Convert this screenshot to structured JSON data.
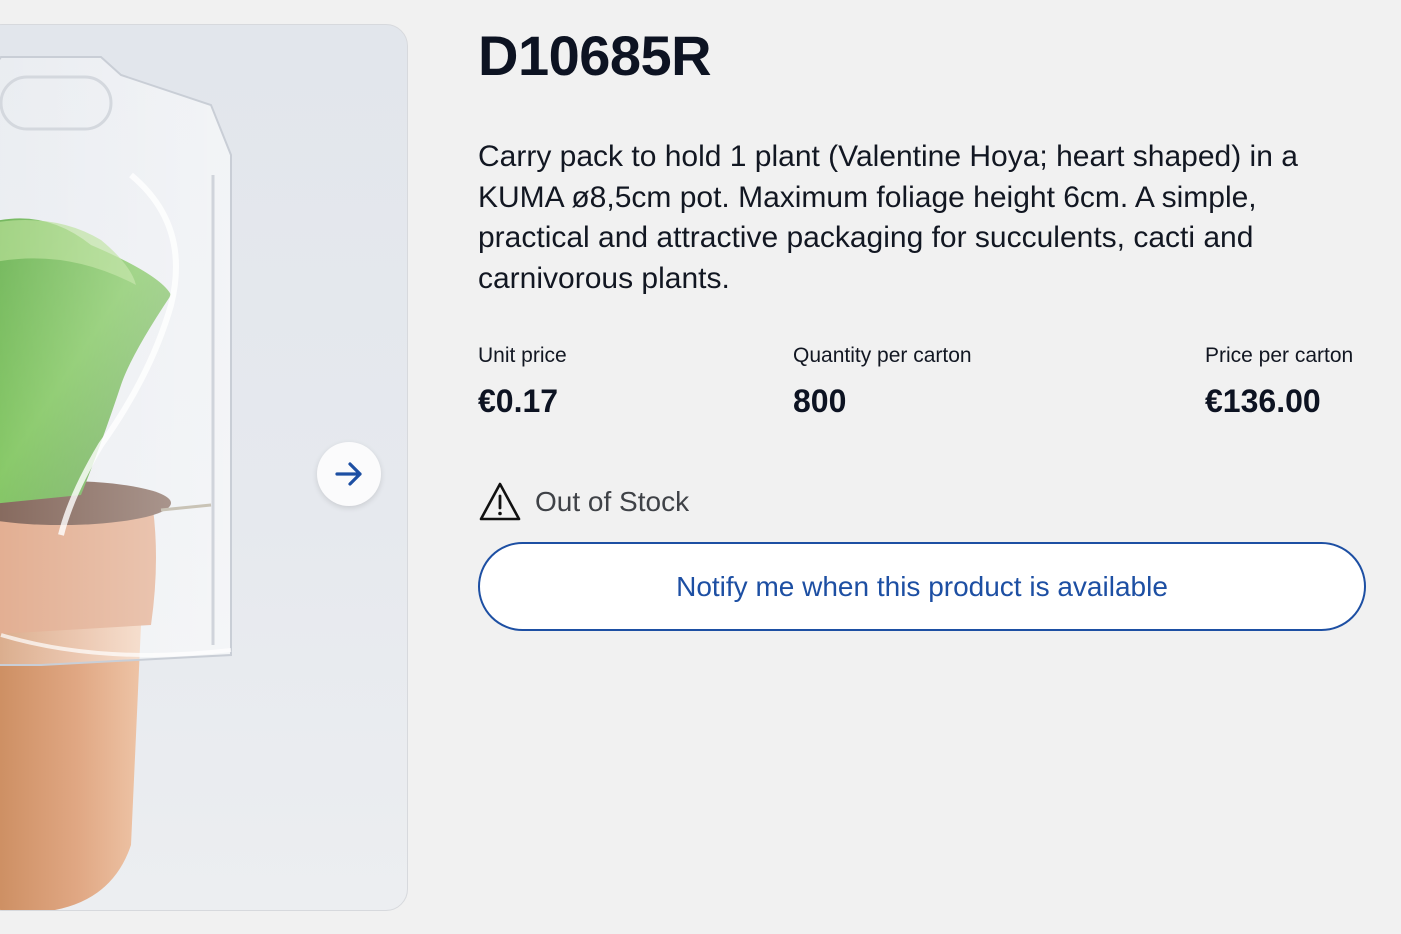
{
  "product": {
    "sku": "D10685R",
    "description": "Carry pack to hold 1 plant (Valentine Hoya; heart shaped) in a KUMA ø8,5cm pot. Maximum foliage height 6cm. A simple, practical and attractive packaging for succulents, cacti and carnivorous plants."
  },
  "gallery": {
    "next_icon": "arrow-right-icon"
  },
  "pricing": {
    "unit_price_label": "Unit price",
    "unit_price_value": "€0.17",
    "quantity_label": "Quantity per carton",
    "quantity_value": "800",
    "carton_price_label": "Price per carton",
    "carton_price_value": "€136.00"
  },
  "stock": {
    "icon": "warning-icon",
    "status": "Out of Stock"
  },
  "actions": {
    "notify_label": "Notify me when this product is available"
  },
  "colors": {
    "accent": "#1d4fa3",
    "background": "#f1f1f1",
    "text": "#0d1322"
  }
}
